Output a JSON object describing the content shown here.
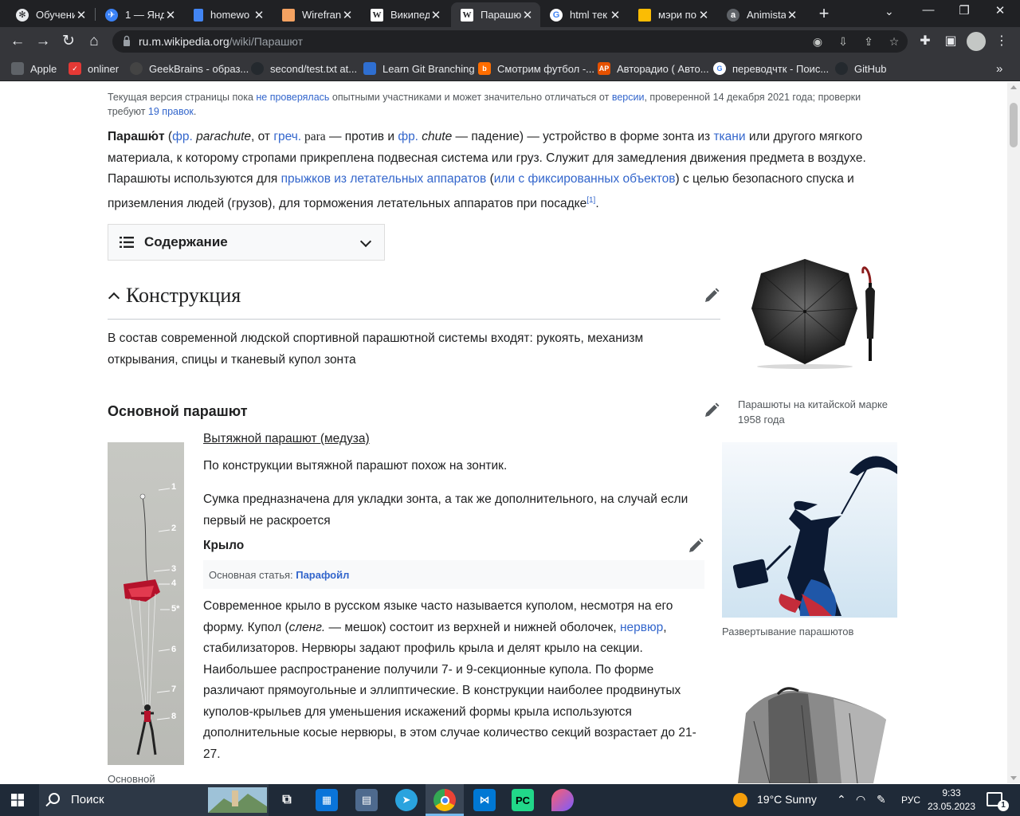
{
  "browser": {
    "tabs": [
      {
        "title": "Обучени",
        "favicon": "openai-icon",
        "color": "#e8eaed"
      },
      {
        "title": "1 — Янд",
        "favicon": "yandex-icon",
        "color": "#3b82f6"
      },
      {
        "title": "homewo",
        "favicon": "docs-icon",
        "color": "#4285f4"
      },
      {
        "title": "Wirefran",
        "favicon": "wireframe-icon",
        "color": "#f4a261"
      },
      {
        "title": "Википед",
        "favicon": "wikipedia-icon",
        "color": "#ffffff"
      },
      {
        "title": "Парашю",
        "favicon": "wikipedia-icon",
        "color": "#ffffff",
        "active": true
      },
      {
        "title": "html тек",
        "favicon": "google-icon",
        "color": "#ffffff"
      },
      {
        "title": "мэри по",
        "favicon": "yandex-images-icon",
        "color": "#fbbc04"
      },
      {
        "title": "Animista",
        "favicon": "animista-icon",
        "color": "#5f6368"
      }
    ],
    "address": {
      "host": "ru.m.wikipedia.org",
      "path": "/wiki/Парашют"
    },
    "bookmarks": [
      {
        "label": "Apple",
        "icon": "apple-icon",
        "color": "#5f6368"
      },
      {
        "label": "onliner",
        "icon": "onliner-icon",
        "color": "#e53935"
      },
      {
        "label": "GeekBrains - образ...",
        "icon": "geekbrains-icon",
        "color": "#444"
      },
      {
        "label": "second/test.txt at...",
        "icon": "github-icon",
        "color": "#24292e"
      },
      {
        "label": "Learn Git Branching",
        "icon": "git-icon",
        "color": "#2f6fd1"
      },
      {
        "label": "Смотрим футбол -...",
        "icon": "football-icon",
        "color": "#ff6d00"
      },
      {
        "label": "Авторадио ( Авто...",
        "icon": "radio-icon",
        "color": "#e65100"
      },
      {
        "label": "переводчтк - Поис...",
        "icon": "google-icon",
        "color": "#ffffff"
      },
      {
        "label": "GitHub",
        "icon": "github-icon",
        "color": "#24292e"
      }
    ]
  },
  "article": {
    "notice": {
      "pre": "Текущая версия страницы пока ",
      "link1": "не проверялась",
      "mid": " опытными участниками и может значительно отличаться от ",
      "link2": "версии",
      "mid2": ", проверенной 14 декабря 2021 года; проверки требуют ",
      "link3": "19 правок",
      "end": "."
    },
    "lead": {
      "term": "Парашю́т",
      "p1": " (",
      "l1": "фр.",
      "i1": " parachute",
      "p2": ", от ",
      "l2": "греч.",
      "g1": " para",
      "p3": " — против и ",
      "l3": "фр.",
      "i2": " chute",
      "p4": " — падение) — устройство в форме зонта из ",
      "l4": "ткани",
      "p5": " или другого мягкого материала, к которому стропами прикреплена подвесная система или груз. Служит для замедления движения предмета в воздухе. Парашюты используются для ",
      "l5": "прыжков из летательных аппаратов",
      "p6": " (",
      "l6": "или с фиксированных объектов",
      "p7": ") с целью безопасного спуска и приземления людей (грузов), для торможения летательных аппаратов при посадке",
      "ref": "[1]",
      "p8": "."
    },
    "toc_title": "Содержание",
    "section_construction": "Конструкция",
    "construction_text": "В состав современной людской спортивной парашютной системы входят: рукоять, механизм открывания, спицы и тканевый купол зонта",
    "main_chute_heading": "Основной парашют",
    "pilot_chute_link": "Вытяжной парашют (медуза)",
    "pilot_text": "По конструкции вытяжной парашют похож на зонтик.",
    "bag_text": "Сумка предназначена для укладки зонта, а так же дополнительного, на случай если первый не раскроется",
    "wing_heading": "Крыло",
    "hatnote_label": "Основная статья: ",
    "hatnote_link": "Парафойл",
    "wing_text": {
      "a": "Современное крыло в русском языке часто называется куполом, несмотря на его форму. Купол (",
      "i": "сленг.",
      "b": " — мешок) состоит из верхней и нижней оболочек, ",
      "link": "нервюр",
      "c": ", стабилизаторов. Нервюры задают профиль крыла и делят крыло на секции. Наибольшее распространение получили 7- и 9-секционные купола. По форме различают прямоугольные и эллиптические. В конструкции наиболее продвинутых куполов-крыльев для уменьшения искажений формы крыла используются дополнительные косые нервюры, в этом случае количество секций возрастает до 21-27."
    },
    "caption_left": "Основной",
    "figure_numbers": [
      "1",
      "2",
      "3",
      "4",
      "5*",
      "6",
      "7",
      "8"
    ],
    "caption_stamp": "Парашюты на китайской марке 1958 года",
    "caption_deploy": "Развертывание парашютов"
  },
  "taskbar": {
    "search_placeholder": "Поиск",
    "weather": "19°C  Sunny",
    "language": "РУС",
    "time": "9:33",
    "date": "23.05.2023",
    "notifications": "1"
  }
}
